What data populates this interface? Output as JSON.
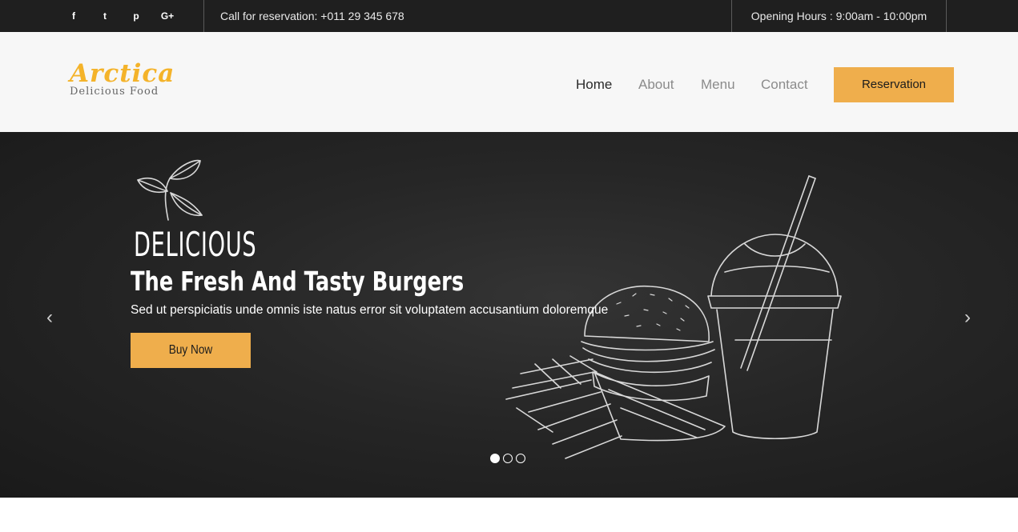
{
  "topbar": {
    "social": [
      {
        "icon": "facebook-icon",
        "glyph": "f"
      },
      {
        "icon": "twitter-icon",
        "glyph": "t"
      },
      {
        "icon": "pinterest-icon",
        "glyph": "p"
      },
      {
        "icon": "google-plus-icon",
        "glyph": "G+"
      }
    ],
    "call": "Call for reservation: +011 29 345 678",
    "hours": "Opening Hours : 9:00am - 10:00pm"
  },
  "header": {
    "logo_title": "Arctica",
    "logo_subtitle": "Delicious Food",
    "nav": [
      {
        "label": "Home",
        "active": true
      },
      {
        "label": "About",
        "active": false
      },
      {
        "label": "Menu",
        "active": false
      },
      {
        "label": "Contact",
        "active": false
      }
    ],
    "reservation_label": "Reservation"
  },
  "hero": {
    "eyebrow": "DELICIOUS",
    "title": "The Fresh And Tasty Burgers",
    "text": "Sed ut perspiciatis unde omnis iste natus error sit voluptatem accusantium doloremque",
    "button_label": "Buy Now",
    "prev_glyph": "‹",
    "next_glyph": "›",
    "slides_count": 3,
    "active_slide": 1
  },
  "colors": {
    "accent": "#efae4c",
    "logo": "#f4b32a",
    "topbar_bg": "#1f1f1f",
    "header_bg": "#f7f7f7",
    "hero_bg": "#262626"
  }
}
